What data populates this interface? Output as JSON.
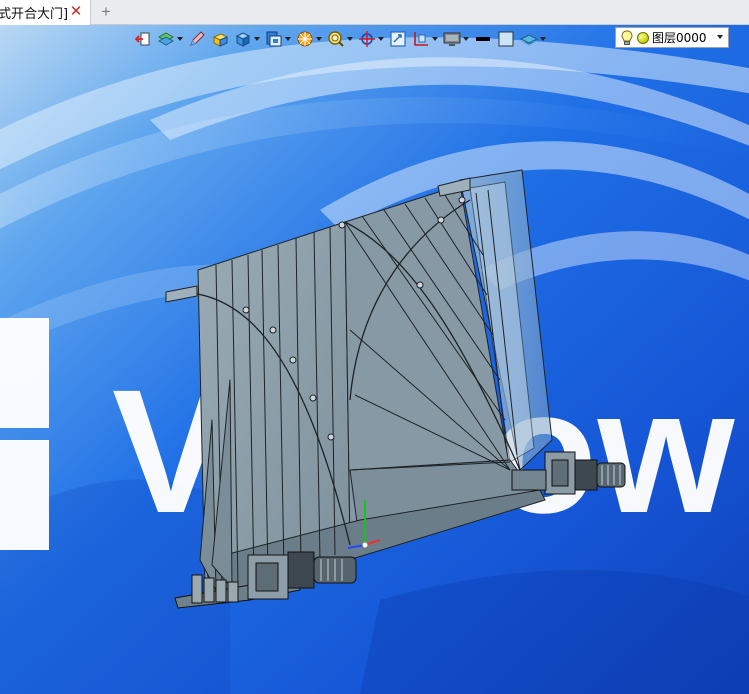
{
  "tab": {
    "title": "式开合大门]",
    "close_glyph": "✕",
    "add_glyph": "+"
  },
  "toolbar": {
    "buttons": [
      {
        "icon": "exit-icon",
        "dropdown": false
      },
      {
        "icon": "layers-stack-icon",
        "dropdown": true
      },
      {
        "icon": "pencil-icon",
        "dropdown": false
      },
      {
        "icon": "solid-block-icon",
        "dropdown": false
      },
      {
        "icon": "cube-view-icon",
        "dropdown": true
      },
      {
        "icon": "display-style-icon",
        "dropdown": true
      },
      {
        "icon": "render-sphere-icon",
        "dropdown": true
      },
      {
        "icon": "zoom-icon",
        "dropdown": true
      },
      {
        "icon": "target-icon",
        "dropdown": true
      },
      {
        "icon": "fit-view-icon",
        "dropdown": false
      },
      {
        "icon": "section-view-icon",
        "dropdown": true
      },
      {
        "icon": "monitor-icon",
        "dropdown": true
      },
      {
        "icon": "line-weight-icon",
        "dropdown": false
      },
      {
        "icon": "color-swatch-icon",
        "dropdown": false
      },
      {
        "icon": "plane-icon",
        "dropdown": true
      }
    ]
  },
  "layer": {
    "name": "图层0000"
  },
  "watermark": {
    "text": "Vindow"
  },
  "colors": {
    "desktop_blue": "#1a64e0",
    "model_fill": "#8c9ea8",
    "model_edge": "#1d2328",
    "tab_close": "#c0322a"
  }
}
